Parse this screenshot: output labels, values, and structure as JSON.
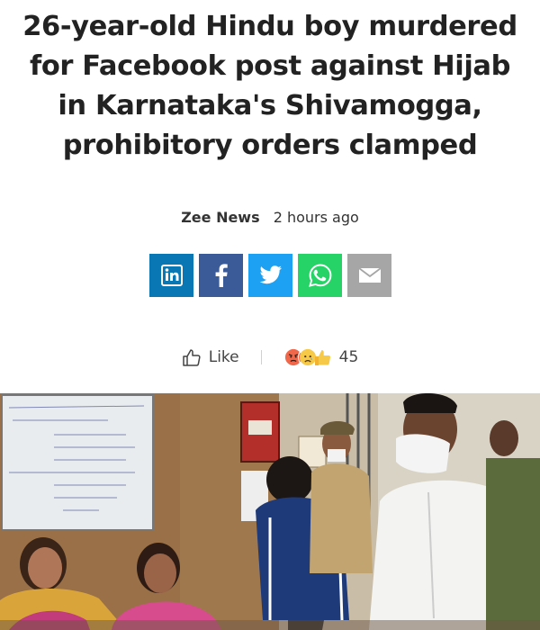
{
  "article": {
    "headline_lines": [
      "26-year-old Hindu boy murdered",
      "for Facebook post against Hijab",
      "in Karnataka's Shivamogga,",
      "prohibitory orders clamped"
    ],
    "source": "Zee News",
    "time_ago": "2 hours ago"
  },
  "share": {
    "buttons": [
      {
        "name": "linkedin",
        "color": "#0a77b5"
      },
      {
        "name": "facebook",
        "color": "#3b5a98"
      },
      {
        "name": "twitter",
        "color": "#1da1f2"
      },
      {
        "name": "whatsapp",
        "color": "#25d366"
      },
      {
        "name": "email",
        "color": "#a6a6a6"
      }
    ]
  },
  "reactions": {
    "like_label": "Like",
    "count": "45",
    "emojis": [
      "angry",
      "sad",
      "thumbs-up"
    ]
  },
  "photo": {
    "description_icon": "news-photo"
  }
}
